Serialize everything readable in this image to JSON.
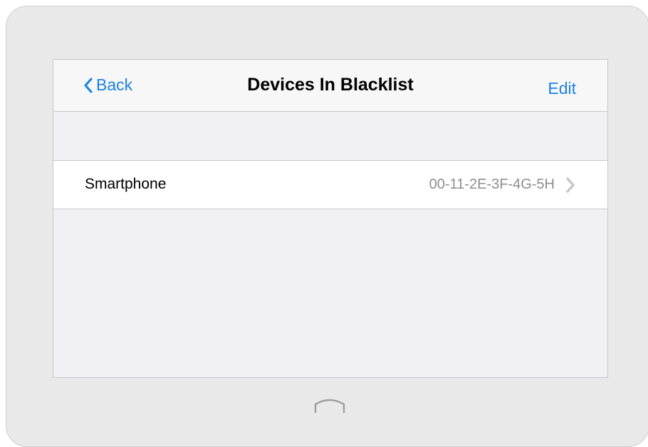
{
  "navbar": {
    "back_label": "Back",
    "title": "Devices In Blacklist",
    "edit_label": "Edit"
  },
  "devices": [
    {
      "name": "Smartphone",
      "mac": "00-11-2E-3F-4G-5H"
    }
  ],
  "icons": {
    "back": "chevron-left-icon",
    "row_disclosure": "chevron-right-icon",
    "home": "home-button-icon"
  },
  "colors": {
    "accent": "#1a82e2",
    "bezel": "#e9e9e9",
    "screen_bg": "#efeff4",
    "secondary_text": "#8e8e93"
  }
}
